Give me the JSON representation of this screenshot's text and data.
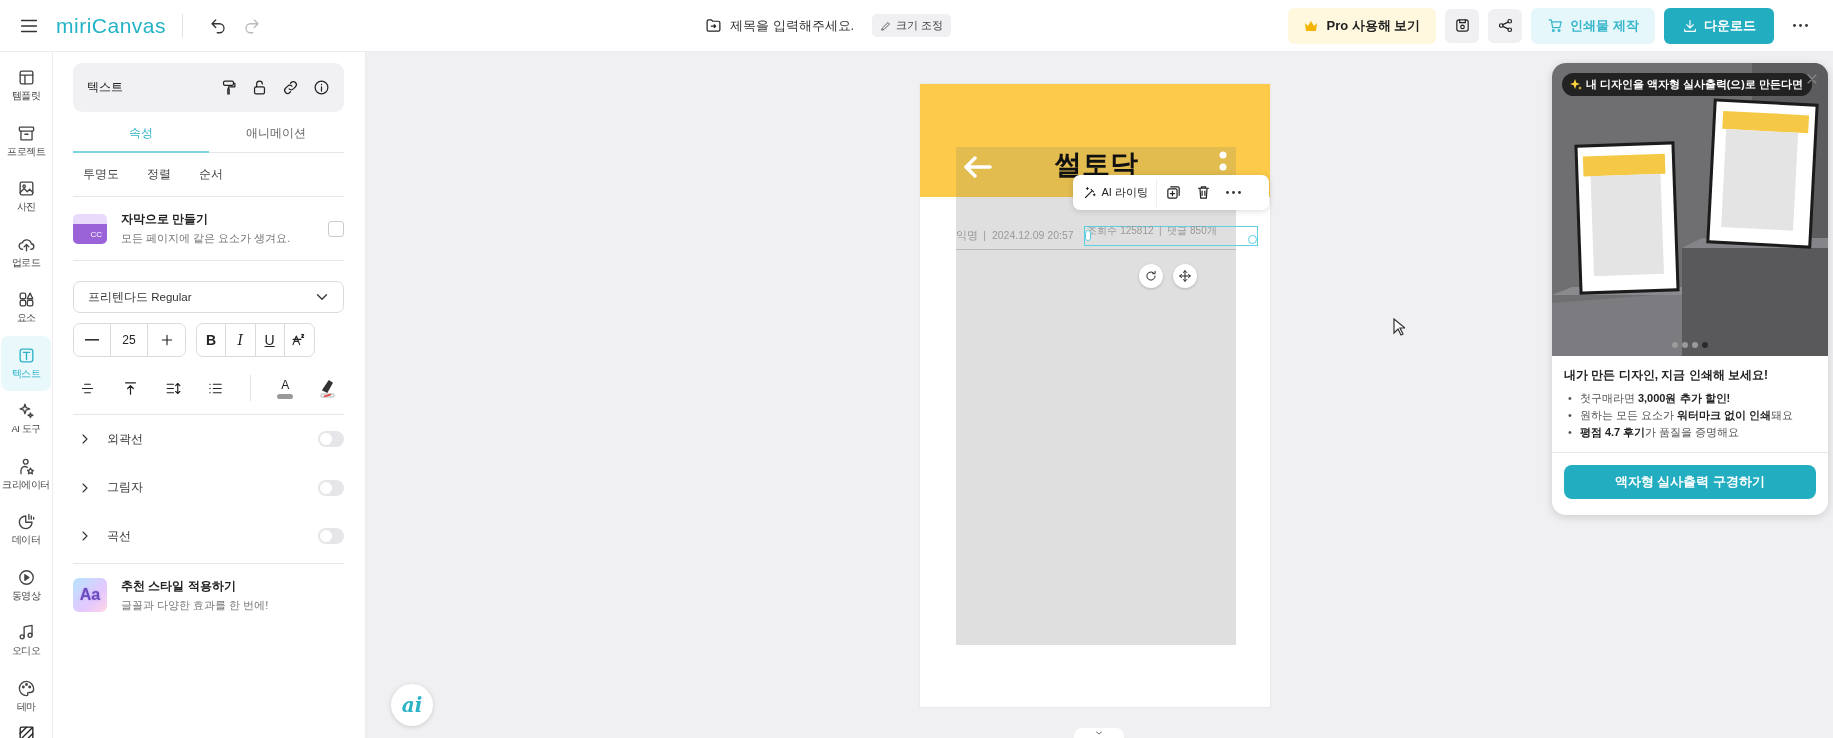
{
  "top_bar": {
    "logo": "miriCanvas",
    "title_placeholder": "제목을 입력해주세요.",
    "resize_button": "크기 조정",
    "pro_button": "Pro 사용해 보기",
    "print_button": "인쇄물 제작",
    "download_button": "다운로드"
  },
  "nav_rail": [
    {
      "label": "템플릿",
      "selected": false
    },
    {
      "label": "프로젝트",
      "selected": false
    },
    {
      "label": "사진",
      "selected": false
    },
    {
      "label": "업로드",
      "selected": false
    },
    {
      "label": "요소",
      "selected": false
    },
    {
      "label": "텍스트",
      "selected": true
    },
    {
      "label": "AI 도구",
      "selected": false
    },
    {
      "label": "크리에이터",
      "selected": false
    },
    {
      "label": "데이터",
      "selected": false
    },
    {
      "label": "동영상",
      "selected": false
    },
    {
      "label": "오디오",
      "selected": false
    },
    {
      "label": "테마",
      "selected": false
    }
  ],
  "panel": {
    "header": "텍스트",
    "tabs": [
      {
        "label": "속성",
        "selected": true
      },
      {
        "label": "애니메이션",
        "selected": false
      }
    ],
    "sub_tabs": [
      "투명도",
      "정렬",
      "순서"
    ],
    "caption_option": {
      "title": "자막으로 만들기",
      "description": "모든 페이지에 같은 요소가 생겨요.",
      "badge": "CC",
      "checked": false
    },
    "font": "프리텐다드 Regular",
    "font_size": "25",
    "format_buttons": [
      "B",
      "I",
      "U"
    ],
    "text_color_label": "A",
    "toggles": [
      {
        "label": "외곽선",
        "on": false
      },
      {
        "label": "그림자",
        "on": false
      },
      {
        "label": "곡선",
        "on": false
      }
    ],
    "recommend": {
      "title": "추천 스타일 적용하기",
      "description": "글꼴과 다양한 효과를 한 번에!",
      "badge": "Aa"
    }
  },
  "canvas": {
    "title": "썰토닥",
    "meta": "익명  |  2024.12.09 20:57",
    "selected_text": "조회수 125812  |  댓글 850개",
    "toolbar": {
      "ai_button": "AI 라이팅"
    },
    "ai_fab": "ai"
  },
  "promo": {
    "tag": "내 디자인을 액자형 실사출력(으)로 만든다면",
    "slides": [
      {
        "selected": false
      },
      {
        "selected": false
      },
      {
        "selected": false
      },
      {
        "selected": true
      }
    ],
    "heading": "내가 만든 디자인, 지금 인쇄해 보세요!",
    "bullets": [
      {
        "marker": "•",
        "text": "첫구매라면 **3,000원 추가 할인!**"
      },
      {
        "marker": "•",
        "text": "원하는 모든 요소가 **워터마크 없이 인쇄**돼요"
      },
      {
        "marker": "•",
        "text": "**평점 4.7 후기**가 품질을 증명해요"
      }
    ],
    "button": "액자형 실사출력 구경하기"
  }
}
